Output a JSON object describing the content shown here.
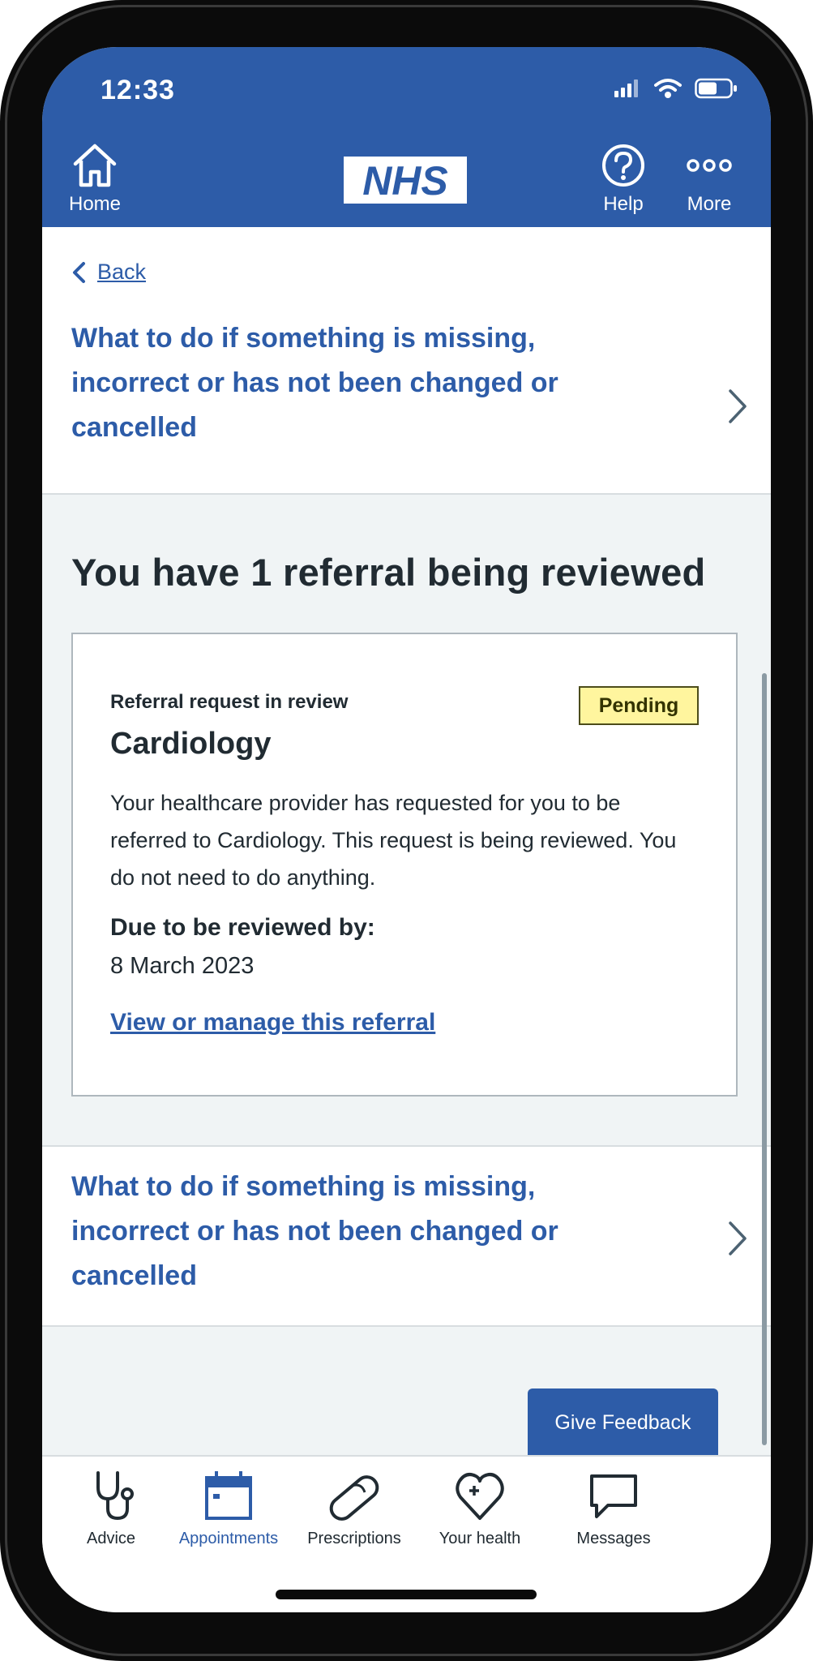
{
  "status": {
    "time": "12:33"
  },
  "header": {
    "home_label": "Home",
    "logo_text": "NHS",
    "help_label": "Help",
    "more_label": "More"
  },
  "back": {
    "label": "Back"
  },
  "help_link_top": {
    "text": "What to do if something is missing, incorrect or has not been changed or cancelled"
  },
  "main": {
    "heading": "You have 1 referral being reviewed",
    "card": {
      "subtitle": "Referral request in review",
      "title": "Cardiology",
      "badge": "Pending",
      "body": "Your healthcare provider has requested for you to be referred to Cardiology. This request is being reviewed. You do not need to do anything.",
      "due_label": "Due to be reviewed by:",
      "due_value": "8 March 2023",
      "manage_link": "View or manage this referral"
    }
  },
  "help_link_bottom": {
    "text": "What to do if something is missing, incorrect or has not been changed or cancelled"
  },
  "feedback_button": "Give Feedback",
  "tabs": [
    {
      "label": "Advice",
      "icon": "stethoscope-icon"
    },
    {
      "label": "Appointments",
      "icon": "calendar-icon",
      "active": true
    },
    {
      "label": "Prescriptions",
      "icon": "pill-icon"
    },
    {
      "label": "Your health",
      "icon": "heart-plus-icon"
    },
    {
      "label": "Messages",
      "icon": "speech-bubble-icon"
    }
  ],
  "colors": {
    "brand_blue": "#2d5ca8",
    "badge_yellow": "#fff59e",
    "page_grey": "#f0f4f5"
  }
}
